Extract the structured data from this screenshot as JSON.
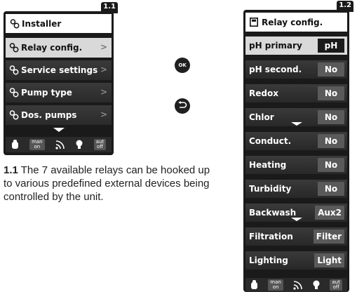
{
  "screen1": {
    "number": "1.1",
    "title": "Installer",
    "items": [
      {
        "label": "Relay config.",
        "selected": true
      },
      {
        "label": "Service settings",
        "selected": false
      },
      {
        "label": "Pump type",
        "selected": false
      },
      {
        "label": "Dos. pumps",
        "selected": false
      }
    ],
    "footer": {
      "mode1": "man\non",
      "mode2": "aut\noff"
    }
  },
  "screen2": {
    "number": "1.2",
    "title": "Relay config.",
    "rows": [
      {
        "label": "pH primary",
        "value": "pH",
        "selected": true
      },
      {
        "label": "pH second.",
        "value": "No",
        "selected": false
      },
      {
        "label": "Redox",
        "value": "No",
        "selected": false
      },
      {
        "label": "Chlor",
        "value": "No",
        "selected": false
      },
      {
        "label": "Conduct.",
        "value": "No",
        "selected": false
      },
      {
        "label": "Heating",
        "value": "No",
        "selected": false
      },
      {
        "label": "Turbidity",
        "value": "No",
        "selected": false
      },
      {
        "label": "Backwash",
        "value": "Aux2",
        "selected": false
      },
      {
        "label": "Filtration",
        "value": "Filter",
        "selected": false
      },
      {
        "label": "Lighting",
        "value": "Light",
        "selected": false
      }
    ],
    "footer": {
      "mode1": "man\non",
      "mode2": "aut\noff"
    }
  },
  "buttons": {
    "ok": "OK",
    "back_icon": "back-arrow-icon"
  },
  "caption": {
    "number": "1.1",
    "text": " The 7 available relays can be hooked up to various predefined external devices being controlled by the unit."
  },
  "colors": {
    "screen_bg": "#1a1a1a",
    "row_dark": "#333333",
    "row_selected": "#d9d9d9",
    "value_bg": "#5a5a5a"
  }
}
